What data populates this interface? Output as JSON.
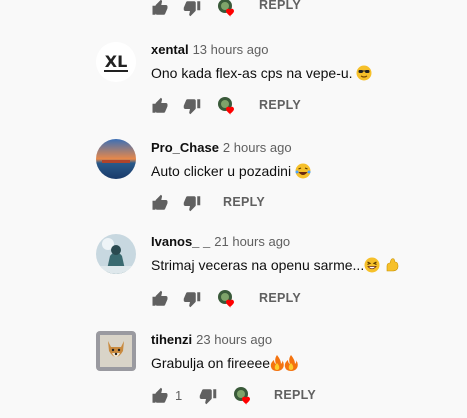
{
  "reply_label": "REPLY",
  "colors": {
    "author": "#0f0f0f",
    "meta": "#606060",
    "icon": "#606060",
    "heart": "#ff0000",
    "background": "#f9f9f9"
  },
  "icons": {
    "like": "thumbs-up-icon",
    "dislike": "thumbs-down-icon",
    "creator_heart": "creator-heart-icon"
  },
  "comments": [
    {
      "author": "xental",
      "time": "13 hours ago",
      "text": "Ono kada flex-as cps na vepe-u. ",
      "emoji": "sunglasses-emoji",
      "avatar": "xl-logo",
      "hearted": true
    },
    {
      "author": "Pro_Chase",
      "time": "2 hours ago",
      "text": "Auto clicker u pozadini ",
      "emoji": "laughing-tears-emoji",
      "avatar": "sunset-photo",
      "hearted": false
    },
    {
      "author": "Ivanos_ _",
      "time": "21 hours ago",
      "text": "Strimaj veceras na openu sarme...",
      "emoji": "grin-flex-emoji",
      "avatar": "winter-photo",
      "hearted": true
    },
    {
      "author": "tihenzi",
      "time": "23 hours ago",
      "text": "Grabulja on fireeee",
      "emoji": "fire-emoji",
      "avatar": "dog-photo",
      "hearted": true,
      "likes": "1"
    }
  ]
}
